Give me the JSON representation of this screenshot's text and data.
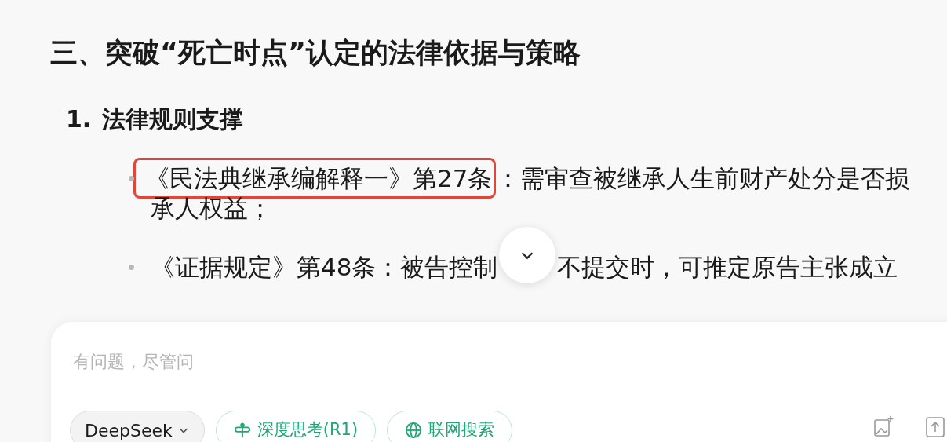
{
  "heading": "三、突破“死亡时点”认定的法律依据与策略",
  "section": {
    "number": "1.",
    "title": "法律规则支撑"
  },
  "bullets": [
    {
      "highlight": "《民法典继承编解释一》第27条",
      "text": "：需审查被继承人生前财产处分是否损",
      "continuation": "承人权益；"
    },
    {
      "text": "《证据规定》第48条：被告控制",
      "after_cover": "不提交时，可推定原告主张成立"
    }
  ],
  "composer": {
    "placeholder": "有问题，尽管问",
    "model": "DeepSeek",
    "toggles": [
      {
        "kind": "think",
        "label": "深度思考(R1)",
        "selected": true
      },
      {
        "kind": "globe",
        "label": "联网搜索",
        "selected": true
      }
    ]
  }
}
